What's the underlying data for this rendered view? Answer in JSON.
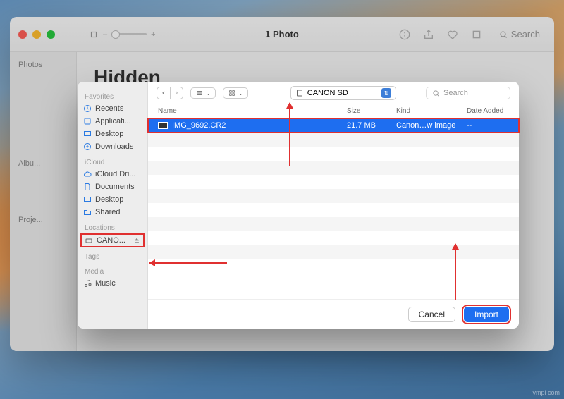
{
  "main_window": {
    "title": "Hidden",
    "photo_count": "1 Photo",
    "search_placeholder": "Search",
    "sidebar": {
      "photos": "Photos",
      "albums": "Albu...",
      "projects": "Proje..."
    }
  },
  "sheet": {
    "toolbar": {
      "location": "CANON SD",
      "search_placeholder": "Search"
    },
    "sidebar": {
      "favorites_label": "Favorites",
      "favorites": [
        {
          "icon": "clock",
          "label": "Recents"
        },
        {
          "icon": "app",
          "label": "Applicati..."
        },
        {
          "icon": "desktop",
          "label": "Desktop"
        },
        {
          "icon": "download",
          "label": "Downloads"
        }
      ],
      "icloud_label": "iCloud",
      "icloud": [
        {
          "icon": "cloud",
          "label": "iCloud Dri..."
        },
        {
          "icon": "doc",
          "label": "Documents"
        },
        {
          "icon": "desktop",
          "label": "Desktop"
        },
        {
          "icon": "folder",
          "label": "Shared"
        }
      ],
      "locations_label": "Locations",
      "locations": [
        {
          "icon": "drive",
          "label": "CANO...",
          "eject": true
        }
      ],
      "tags_label": "Tags",
      "media_label": "Media",
      "media": [
        {
          "icon": "music",
          "label": "Music"
        }
      ]
    },
    "columns": {
      "name": "Name",
      "size": "Size",
      "kind": "Kind",
      "date": "Date Added"
    },
    "files": [
      {
        "name": "IMG_9692.CR2",
        "size": "21.7 MB",
        "kind": "Canon…w image",
        "date": "--",
        "selected": true
      }
    ],
    "buttons": {
      "cancel": "Cancel",
      "import": "Import"
    }
  },
  "watermark": "vmpi com"
}
